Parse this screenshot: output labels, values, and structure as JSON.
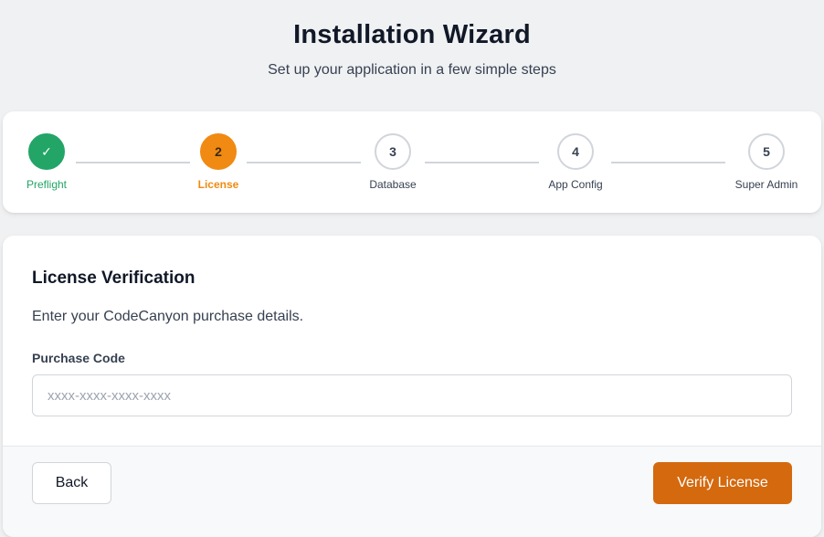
{
  "header": {
    "title": "Installation Wizard",
    "subtitle": "Set up your application in a few simple steps"
  },
  "steps": [
    {
      "number": "✓",
      "label": "Preflight",
      "state": "done"
    },
    {
      "number": "2",
      "label": "License",
      "state": "active"
    },
    {
      "number": "3",
      "label": "Database",
      "state": "pending"
    },
    {
      "number": "4",
      "label": "App Config",
      "state": "pending"
    },
    {
      "number": "5",
      "label": "Super Admin",
      "state": "pending"
    }
  ],
  "form": {
    "title": "License Verification",
    "description": "Enter your CodeCanyon purchase details.",
    "purchase_code_label": "Purchase Code",
    "purchase_code_value": "",
    "purchase_code_placeholder": "xxxx-xxxx-xxxx-xxxx"
  },
  "footer": {
    "back_label": "Back",
    "verify_label": "Verify License"
  },
  "colors": {
    "done": "#22a566",
    "active": "#f08a12",
    "primary_button": "#d4690e"
  }
}
